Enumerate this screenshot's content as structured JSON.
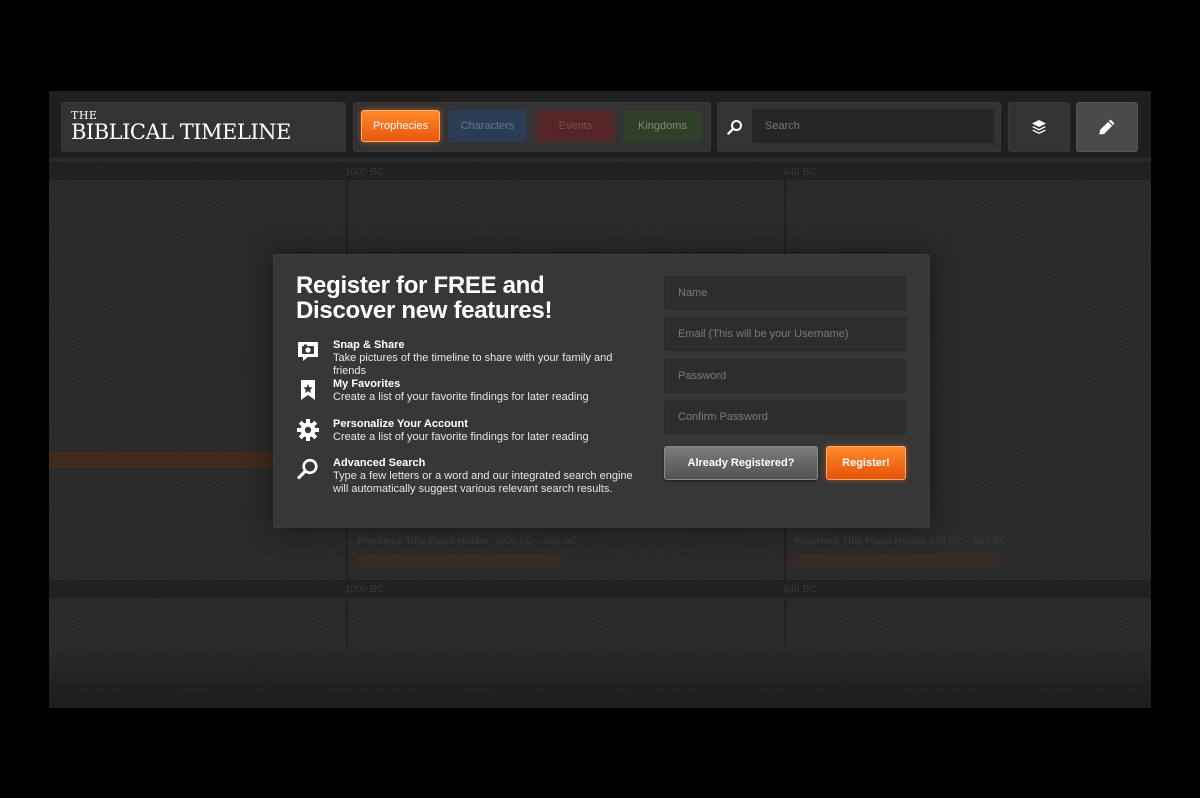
{
  "brand": {
    "line1": "THE",
    "line2": "BIBLICAL TIMELINE"
  },
  "nav": {
    "tabs": [
      {
        "label": "Prophecies",
        "active": true,
        "color": "#f26b1d"
      },
      {
        "label": "Characters",
        "active": false,
        "color": "#2b3d53"
      },
      {
        "label": "Events",
        "active": false,
        "color": "#522527"
      },
      {
        "label": "Kingdoms",
        "active": false,
        "color": "#2f3f2a"
      }
    ]
  },
  "search": {
    "placeholder": "Search",
    "icon": "search-icon"
  },
  "toolbar": {
    "layers_icon": "layers-icon",
    "edit_icon": "pencil-icon"
  },
  "timeline": {
    "markers": [
      "1000 BC",
      "940 BC",
      "1000 BC",
      "940 BC"
    ],
    "items": [
      {
        "title": "Prophecy Title Place Holder",
        "range": "1000 BC – 970 BC"
      },
      {
        "title": "Prophecy Title Place Holder",
        "range": "940 BC – 912 BC"
      }
    ]
  },
  "modal": {
    "title": "Register for FREE and Discover new features!",
    "features": [
      {
        "icon": "camera-icon",
        "title": "Snap & Share",
        "desc": "Take pictures of the timeline to share with your family and friends"
      },
      {
        "icon": "bookmark-star-icon",
        "title": "My Favorites",
        "desc": "Create a list of your favorite findings for later reading"
      },
      {
        "icon": "gear-icon",
        "title": "Personalize Your Account",
        "desc": "Create a list of your favorite findings for later reading"
      },
      {
        "icon": "search-icon",
        "title": "Advanced Search",
        "desc": "Type a few letters or a word and our integrated search engine will automatically suggest various relevant search results."
      }
    ],
    "form": {
      "name_placeholder": "Name",
      "email_placeholder": "Email (This will be your Username)",
      "password_placeholder": "Password",
      "confirm_placeholder": "Confirm Password",
      "already_label": "Already Registered?",
      "register_label": "Register!"
    }
  },
  "colors": {
    "accent": "#f26b1d",
    "modal_bg": "#373737",
    "page_bg": "#2a2a2a"
  }
}
